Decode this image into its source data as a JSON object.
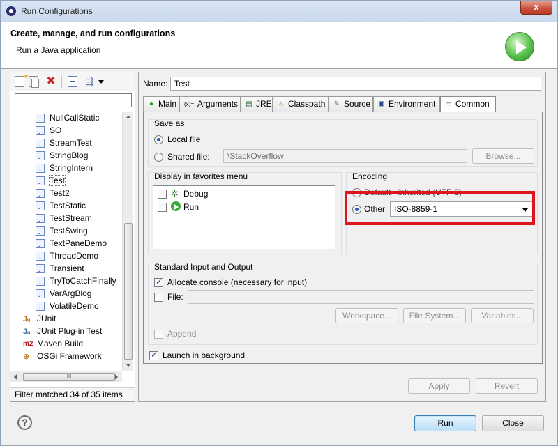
{
  "window": {
    "title": "Run Configurations",
    "close_label": "x"
  },
  "banner": {
    "title": "Create, manage, and run configurations",
    "subtitle": "Run a Java application"
  },
  "left": {
    "filter_value": "",
    "items": [
      {
        "label": "NullCallStatic",
        "icon": "java-class-icon",
        "selected": false
      },
      {
        "label": "SO",
        "icon": "java-class-icon",
        "selected": false
      },
      {
        "label": "StreamTest",
        "icon": "java-class-icon",
        "selected": false
      },
      {
        "label": "StringBlog",
        "icon": "java-class-icon",
        "selected": false
      },
      {
        "label": "StringIntern",
        "icon": "java-class-icon",
        "selected": false
      },
      {
        "label": "Test",
        "icon": "java-class-icon",
        "selected": true
      },
      {
        "label": "Test2",
        "icon": "java-class-icon",
        "selected": false
      },
      {
        "label": "TestStatic",
        "icon": "java-class-icon",
        "selected": false
      },
      {
        "label": "TestStream",
        "icon": "java-class-icon",
        "selected": false
      },
      {
        "label": "TestSwing",
        "icon": "java-class-icon",
        "selected": false
      },
      {
        "label": "TextPaneDemo",
        "icon": "java-class-icon",
        "selected": false
      },
      {
        "label": "ThreadDemo",
        "icon": "java-class-icon",
        "selected": false
      },
      {
        "label": "Transient",
        "icon": "java-class-icon",
        "selected": false
      },
      {
        "label": "TryToCatchFinally",
        "icon": "java-class-icon",
        "selected": false
      },
      {
        "label": "VarArgBlog",
        "icon": "java-class-icon",
        "selected": false
      },
      {
        "label": "VolatileDemo",
        "icon": "java-class-icon",
        "selected": false
      }
    ],
    "categories": [
      {
        "label": "JUnit",
        "icon": "junit-icon",
        "glyph": "Jᵤ"
      },
      {
        "label": "JUnit Plug-in Test",
        "icon": "junit-plugin-icon",
        "glyph": "Jᵤ"
      },
      {
        "label": "Maven Build",
        "icon": "maven-icon",
        "glyph": "m2"
      },
      {
        "label": "OSGi Framework",
        "icon": "osgi-icon",
        "glyph": "⊕"
      }
    ],
    "hscroll_grip": "III",
    "status": "Filter matched 34 of 35 items"
  },
  "right": {
    "name_label": "Name:",
    "name_value": "Test",
    "tabs": [
      {
        "label": "Main",
        "icon": "main-tab-icon",
        "glyph": "●"
      },
      {
        "label": "Arguments",
        "icon": "arguments-tab-icon",
        "glyph": "(x)="
      },
      {
        "label": "JRE",
        "icon": "jre-tab-icon",
        "glyph": "▤"
      },
      {
        "label": "Classpath",
        "icon": "classpath-tab-icon",
        "glyph": "⟡"
      },
      {
        "label": "Source",
        "icon": "source-tab-icon",
        "glyph": "✎"
      },
      {
        "label": "Environment",
        "icon": "environment-tab-icon",
        "glyph": "▣"
      },
      {
        "label": "Common",
        "icon": "common-tab-icon",
        "glyph": "▭"
      }
    ],
    "save_as": {
      "title": "Save as",
      "local_file_label": "Local file",
      "shared_file_label": "Shared file:",
      "shared_file_value": "\\StackOverflow",
      "browse_label": "Browse..."
    },
    "favorites": {
      "title": "Display in favorites menu",
      "items": [
        {
          "label": "Debug",
          "checked": false,
          "icon": "debug-bug-icon"
        },
        {
          "label": "Run",
          "checked": false,
          "icon": "run-icon"
        }
      ]
    },
    "encoding": {
      "title": "Encoding",
      "default_label": "Default - inherited (UTF-8)",
      "other_label": "Other",
      "selected_encoding": "ISO-8859-1"
    },
    "std_io": {
      "title": "Standard Input and Output",
      "allocate_label": "Allocate console (necessary for input)",
      "file_label": "File:",
      "file_value": "",
      "workspace_label": "Workspace...",
      "filesystem_label": "File System...",
      "variables_label": "Variables...",
      "append_label": "Append"
    },
    "launch_bg_label": "Launch in background",
    "apply_label": "Apply",
    "revert_label": "Revert"
  },
  "footer": {
    "help_label": "?",
    "run_label": "Run",
    "close_label": "Close"
  },
  "colors": {
    "highlight": "#e0141e",
    "run_green": "#57c04b"
  }
}
